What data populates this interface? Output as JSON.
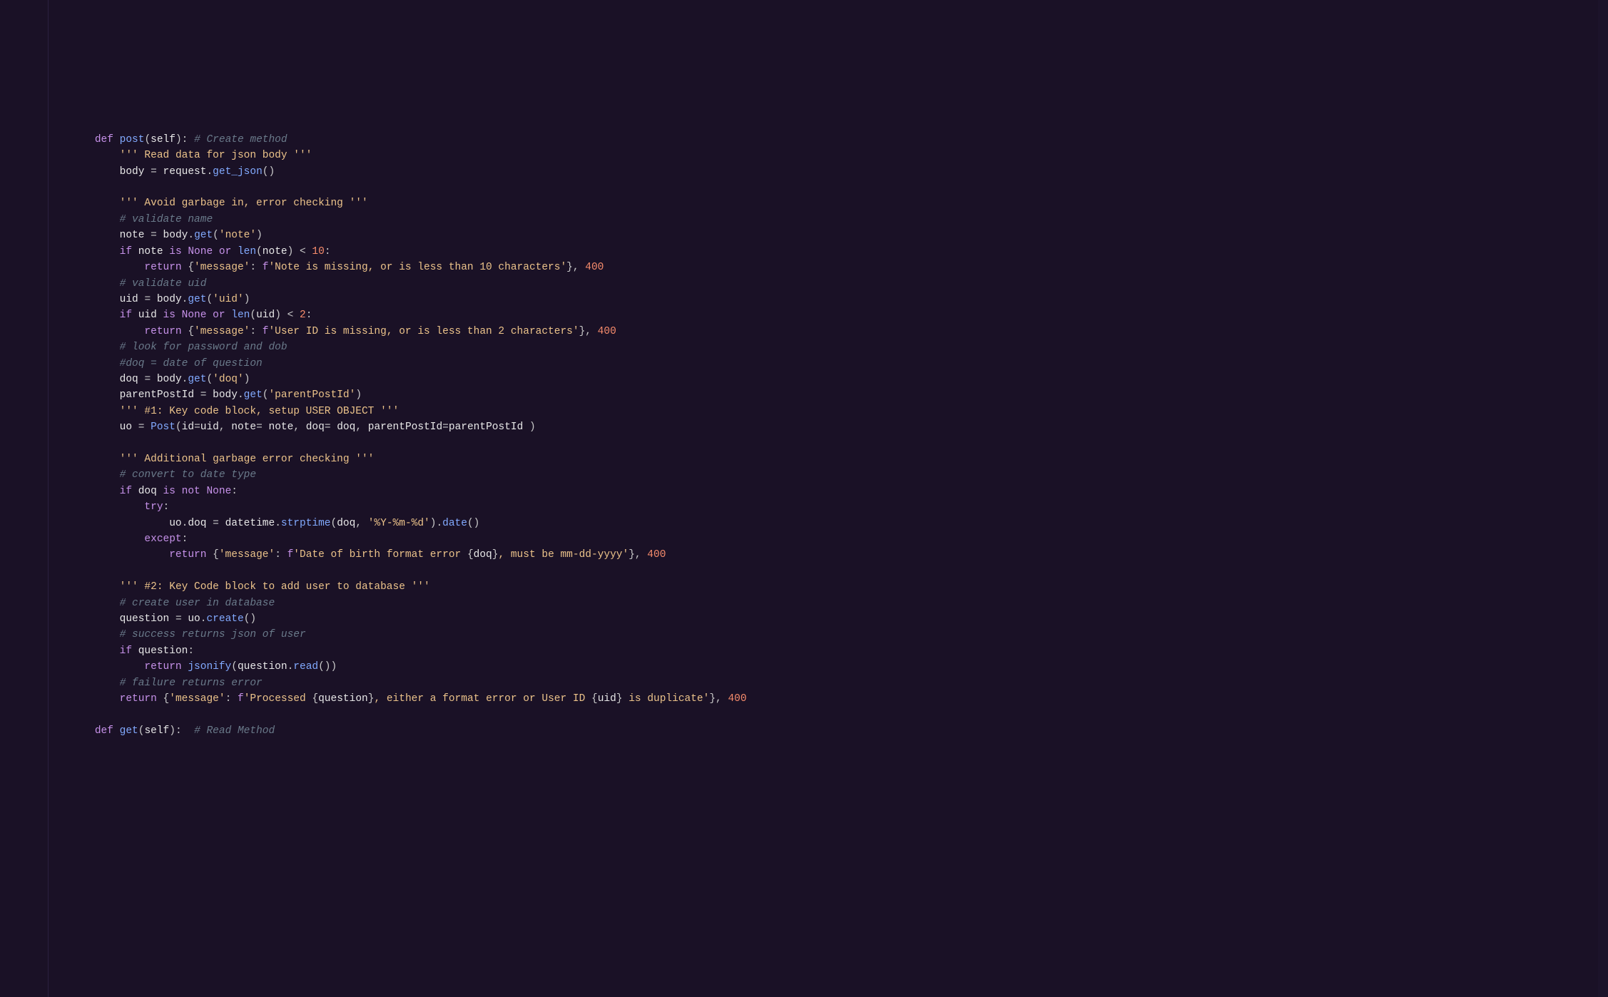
{
  "code": {
    "lines": [
      {
        "i": 1,
        "segs": [
          {
            "c": "kw",
            "t": "def"
          },
          {
            "t": " "
          },
          {
            "c": "fn",
            "t": "post"
          },
          {
            "c": "punc",
            "t": "("
          },
          {
            "c": "param",
            "t": "self"
          },
          {
            "c": "punc",
            "t": "): "
          },
          {
            "c": "comment",
            "t": "# Create method"
          }
        ]
      },
      {
        "i": 2,
        "segs": [
          {
            "c": "strdoc",
            "t": "''' Read data for json body '''"
          }
        ]
      },
      {
        "i": 2,
        "segs": [
          {
            "c": "var",
            "t": "body"
          },
          {
            "t": " "
          },
          {
            "c": "op",
            "t": "="
          },
          {
            "t": " "
          },
          {
            "c": "var",
            "t": "request"
          },
          {
            "c": "punc",
            "t": "."
          },
          {
            "c": "call",
            "t": "get_json"
          },
          {
            "c": "punc",
            "t": "()"
          }
        ]
      },
      {
        "i": 0,
        "segs": []
      },
      {
        "i": 2,
        "segs": [
          {
            "c": "strdoc",
            "t": "''' Avoid garbage in, error checking '''"
          }
        ]
      },
      {
        "i": 2,
        "segs": [
          {
            "c": "comment",
            "t": "# validate name"
          }
        ]
      },
      {
        "i": 2,
        "segs": [
          {
            "c": "var",
            "t": "note"
          },
          {
            "t": " "
          },
          {
            "c": "op",
            "t": "="
          },
          {
            "t": " "
          },
          {
            "c": "var",
            "t": "body"
          },
          {
            "c": "punc",
            "t": "."
          },
          {
            "c": "call",
            "t": "get"
          },
          {
            "c": "punc",
            "t": "("
          },
          {
            "c": "str",
            "t": "'note'"
          },
          {
            "c": "punc",
            "t": ")"
          }
        ]
      },
      {
        "i": 2,
        "segs": [
          {
            "c": "kw",
            "t": "if"
          },
          {
            "t": " "
          },
          {
            "c": "var",
            "t": "note"
          },
          {
            "t": " "
          },
          {
            "c": "kw",
            "t": "is"
          },
          {
            "t": " "
          },
          {
            "c": "const",
            "t": "None"
          },
          {
            "t": " "
          },
          {
            "c": "kw",
            "t": "or"
          },
          {
            "t": " "
          },
          {
            "c": "call",
            "t": "len"
          },
          {
            "c": "punc",
            "t": "("
          },
          {
            "c": "var",
            "t": "note"
          },
          {
            "c": "punc",
            "t": ")"
          },
          {
            "t": " "
          },
          {
            "c": "op",
            "t": "<"
          },
          {
            "t": " "
          },
          {
            "c": "num",
            "t": "10"
          },
          {
            "c": "punc",
            "t": ":"
          }
        ]
      },
      {
        "i": 3,
        "segs": [
          {
            "c": "kw",
            "t": "return"
          },
          {
            "t": " "
          },
          {
            "c": "punc",
            "t": "{"
          },
          {
            "c": "str",
            "t": "'message'"
          },
          {
            "c": "punc",
            "t": ": "
          },
          {
            "c": "kw",
            "t": "f"
          },
          {
            "c": "str",
            "t": "'Note is missing, or is less than 10 characters'"
          },
          {
            "c": "punc",
            "t": "}, "
          },
          {
            "c": "num",
            "t": "400"
          }
        ]
      },
      {
        "i": 2,
        "segs": [
          {
            "c": "comment",
            "t": "# validate uid"
          }
        ]
      },
      {
        "i": 2,
        "segs": [
          {
            "c": "var",
            "t": "uid"
          },
          {
            "t": " "
          },
          {
            "c": "op",
            "t": "="
          },
          {
            "t": " "
          },
          {
            "c": "var",
            "t": "body"
          },
          {
            "c": "punc",
            "t": "."
          },
          {
            "c": "call",
            "t": "get"
          },
          {
            "c": "punc",
            "t": "("
          },
          {
            "c": "str",
            "t": "'uid'"
          },
          {
            "c": "punc",
            "t": ")"
          }
        ]
      },
      {
        "i": 2,
        "segs": [
          {
            "c": "kw",
            "t": "if"
          },
          {
            "t": " "
          },
          {
            "c": "var",
            "t": "uid"
          },
          {
            "t": " "
          },
          {
            "c": "kw",
            "t": "is"
          },
          {
            "t": " "
          },
          {
            "c": "const",
            "t": "None"
          },
          {
            "t": " "
          },
          {
            "c": "kw",
            "t": "or"
          },
          {
            "t": " "
          },
          {
            "c": "call",
            "t": "len"
          },
          {
            "c": "punc",
            "t": "("
          },
          {
            "c": "var",
            "t": "uid"
          },
          {
            "c": "punc",
            "t": ")"
          },
          {
            "t": " "
          },
          {
            "c": "op",
            "t": "<"
          },
          {
            "t": " "
          },
          {
            "c": "num",
            "t": "2"
          },
          {
            "c": "punc",
            "t": ":"
          }
        ]
      },
      {
        "i": 3,
        "segs": [
          {
            "c": "kw",
            "t": "return"
          },
          {
            "t": " "
          },
          {
            "c": "punc",
            "t": "{"
          },
          {
            "c": "str",
            "t": "'message'"
          },
          {
            "c": "punc",
            "t": ": "
          },
          {
            "c": "kw",
            "t": "f"
          },
          {
            "c": "str",
            "t": "'User ID is missing, or is less than 2 characters'"
          },
          {
            "c": "punc",
            "t": "}, "
          },
          {
            "c": "num",
            "t": "400"
          }
        ]
      },
      {
        "i": 2,
        "segs": [
          {
            "c": "comment",
            "t": "# look for password and dob"
          }
        ]
      },
      {
        "i": 2,
        "segs": [
          {
            "c": "comment",
            "t": "#doq = date of question"
          }
        ]
      },
      {
        "i": 2,
        "segs": [
          {
            "c": "var",
            "t": "doq"
          },
          {
            "t": " "
          },
          {
            "c": "op",
            "t": "="
          },
          {
            "t": " "
          },
          {
            "c": "var",
            "t": "body"
          },
          {
            "c": "punc",
            "t": "."
          },
          {
            "c": "call",
            "t": "get"
          },
          {
            "c": "punc",
            "t": "("
          },
          {
            "c": "str",
            "t": "'doq'"
          },
          {
            "c": "punc",
            "t": ")"
          }
        ]
      },
      {
        "i": 2,
        "segs": [
          {
            "c": "var",
            "t": "parentPostId"
          },
          {
            "t": " "
          },
          {
            "c": "op",
            "t": "="
          },
          {
            "t": " "
          },
          {
            "c": "var",
            "t": "body"
          },
          {
            "c": "punc",
            "t": "."
          },
          {
            "c": "call",
            "t": "get"
          },
          {
            "c": "punc",
            "t": "("
          },
          {
            "c": "str",
            "t": "'parentPostId'"
          },
          {
            "c": "punc",
            "t": ")"
          }
        ]
      },
      {
        "i": 2,
        "segs": [
          {
            "c": "strdoc",
            "t": "''' #1: Key code block, setup USER OBJECT '''"
          }
        ]
      },
      {
        "i": 2,
        "segs": [
          {
            "c": "var",
            "t": "uo"
          },
          {
            "t": " "
          },
          {
            "c": "op",
            "t": "="
          },
          {
            "t": " "
          },
          {
            "c": "call",
            "t": "Post"
          },
          {
            "c": "punc",
            "t": "("
          },
          {
            "c": "kwarg",
            "t": "id"
          },
          {
            "c": "op",
            "t": "="
          },
          {
            "c": "var",
            "t": "uid"
          },
          {
            "c": "punc",
            "t": ", "
          },
          {
            "c": "kwarg",
            "t": "note"
          },
          {
            "c": "op",
            "t": "= "
          },
          {
            "c": "var",
            "t": "note"
          },
          {
            "c": "punc",
            "t": ", "
          },
          {
            "c": "kwarg",
            "t": "doq"
          },
          {
            "c": "op",
            "t": "= "
          },
          {
            "c": "var",
            "t": "doq"
          },
          {
            "c": "punc",
            "t": ", "
          },
          {
            "c": "kwarg",
            "t": "parentPostId"
          },
          {
            "c": "op",
            "t": "="
          },
          {
            "c": "var",
            "t": "parentPostId"
          },
          {
            "t": " "
          },
          {
            "c": "punc",
            "t": ")"
          }
        ]
      },
      {
        "i": 0,
        "segs": []
      },
      {
        "i": 2,
        "segs": [
          {
            "c": "strdoc",
            "t": "''' Additional garbage error checking '''"
          }
        ]
      },
      {
        "i": 2,
        "segs": [
          {
            "c": "comment",
            "t": "# convert to date type"
          }
        ]
      },
      {
        "i": 2,
        "segs": [
          {
            "c": "kw",
            "t": "if"
          },
          {
            "t": " "
          },
          {
            "c": "var",
            "t": "doq"
          },
          {
            "t": " "
          },
          {
            "c": "kw",
            "t": "is"
          },
          {
            "t": " "
          },
          {
            "c": "kw",
            "t": "not"
          },
          {
            "t": " "
          },
          {
            "c": "const",
            "t": "None"
          },
          {
            "c": "punc",
            "t": ":"
          }
        ]
      },
      {
        "i": 3,
        "segs": [
          {
            "c": "kw",
            "t": "try"
          },
          {
            "c": "punc",
            "t": ":"
          }
        ]
      },
      {
        "i": 4,
        "segs": [
          {
            "c": "var",
            "t": "uo"
          },
          {
            "c": "punc",
            "t": "."
          },
          {
            "c": "var",
            "t": "doq"
          },
          {
            "t": " "
          },
          {
            "c": "op",
            "t": "="
          },
          {
            "t": " "
          },
          {
            "c": "var",
            "t": "datetime"
          },
          {
            "c": "punc",
            "t": "."
          },
          {
            "c": "call",
            "t": "strptime"
          },
          {
            "c": "punc",
            "t": "("
          },
          {
            "c": "var",
            "t": "doq"
          },
          {
            "c": "punc",
            "t": ", "
          },
          {
            "c": "str",
            "t": "'%Y-%m-%d'"
          },
          {
            "c": "punc",
            "t": ")."
          },
          {
            "c": "call",
            "t": "date"
          },
          {
            "c": "punc",
            "t": "()"
          }
        ]
      },
      {
        "i": 3,
        "segs": [
          {
            "c": "kw",
            "t": "except"
          },
          {
            "c": "punc",
            "t": ":"
          }
        ]
      },
      {
        "i": 4,
        "segs": [
          {
            "c": "kw",
            "t": "return"
          },
          {
            "t": " "
          },
          {
            "c": "punc",
            "t": "{"
          },
          {
            "c": "str",
            "t": "'message'"
          },
          {
            "c": "punc",
            "t": ": "
          },
          {
            "c": "kw",
            "t": "f"
          },
          {
            "c": "str",
            "t": "'Date of birth format error "
          },
          {
            "c": "punc",
            "t": "{"
          },
          {
            "c": "var",
            "t": "doq"
          },
          {
            "c": "punc",
            "t": "}"
          },
          {
            "c": "str",
            "t": ", must be mm-dd-yyyy'"
          },
          {
            "c": "punc",
            "t": "}, "
          },
          {
            "c": "num",
            "t": "400"
          }
        ]
      },
      {
        "i": 0,
        "segs": []
      },
      {
        "i": 2,
        "segs": [
          {
            "c": "strdoc",
            "t": "''' #2: Key Code block to add user to database '''"
          }
        ]
      },
      {
        "i": 2,
        "segs": [
          {
            "c": "comment",
            "t": "# create user in database"
          }
        ]
      },
      {
        "i": 2,
        "segs": [
          {
            "c": "var",
            "t": "question"
          },
          {
            "t": " "
          },
          {
            "c": "op",
            "t": "="
          },
          {
            "t": " "
          },
          {
            "c": "var",
            "t": "uo"
          },
          {
            "c": "punc",
            "t": "."
          },
          {
            "c": "call",
            "t": "create"
          },
          {
            "c": "punc",
            "t": "()"
          }
        ]
      },
      {
        "i": 2,
        "segs": [
          {
            "c": "comment",
            "t": "# success returns json of user"
          }
        ]
      },
      {
        "i": 2,
        "segs": [
          {
            "c": "kw",
            "t": "if"
          },
          {
            "t": " "
          },
          {
            "c": "var",
            "t": "question"
          },
          {
            "c": "punc",
            "t": ":"
          }
        ]
      },
      {
        "i": 3,
        "segs": [
          {
            "c": "kw",
            "t": "return"
          },
          {
            "t": " "
          },
          {
            "c": "call",
            "t": "jsonify"
          },
          {
            "c": "punc",
            "t": "("
          },
          {
            "c": "var",
            "t": "question"
          },
          {
            "c": "punc",
            "t": "."
          },
          {
            "c": "call",
            "t": "read"
          },
          {
            "c": "punc",
            "t": "())"
          }
        ]
      },
      {
        "i": 2,
        "segs": [
          {
            "c": "comment",
            "t": "# failure returns error"
          }
        ]
      },
      {
        "i": 2,
        "segs": [
          {
            "c": "kw",
            "t": "return"
          },
          {
            "t": " "
          },
          {
            "c": "punc",
            "t": "{"
          },
          {
            "c": "str",
            "t": "'message'"
          },
          {
            "c": "punc",
            "t": ": "
          },
          {
            "c": "kw",
            "t": "f"
          },
          {
            "c": "str",
            "t": "'Processed "
          },
          {
            "c": "punc",
            "t": "{"
          },
          {
            "c": "var",
            "t": "question"
          },
          {
            "c": "punc",
            "t": "}"
          },
          {
            "c": "str",
            "t": ", either a format error or User ID "
          },
          {
            "c": "punc",
            "t": "{"
          },
          {
            "c": "var",
            "t": "uid"
          },
          {
            "c": "punc",
            "t": "}"
          },
          {
            "c": "str",
            "t": " is duplicate'"
          },
          {
            "c": "punc",
            "t": "}, "
          },
          {
            "c": "num",
            "t": "400"
          }
        ]
      },
      {
        "i": 0,
        "segs": []
      },
      {
        "i": 1,
        "segs": [
          {
            "c": "kw",
            "t": "def"
          },
          {
            "t": " "
          },
          {
            "c": "fn",
            "t": "get"
          },
          {
            "c": "punc",
            "t": "("
          },
          {
            "c": "param",
            "t": "self"
          },
          {
            "c": "punc",
            "t": "):  "
          },
          {
            "c": "comment",
            "t": "# Read Method"
          }
        ]
      }
    ]
  }
}
